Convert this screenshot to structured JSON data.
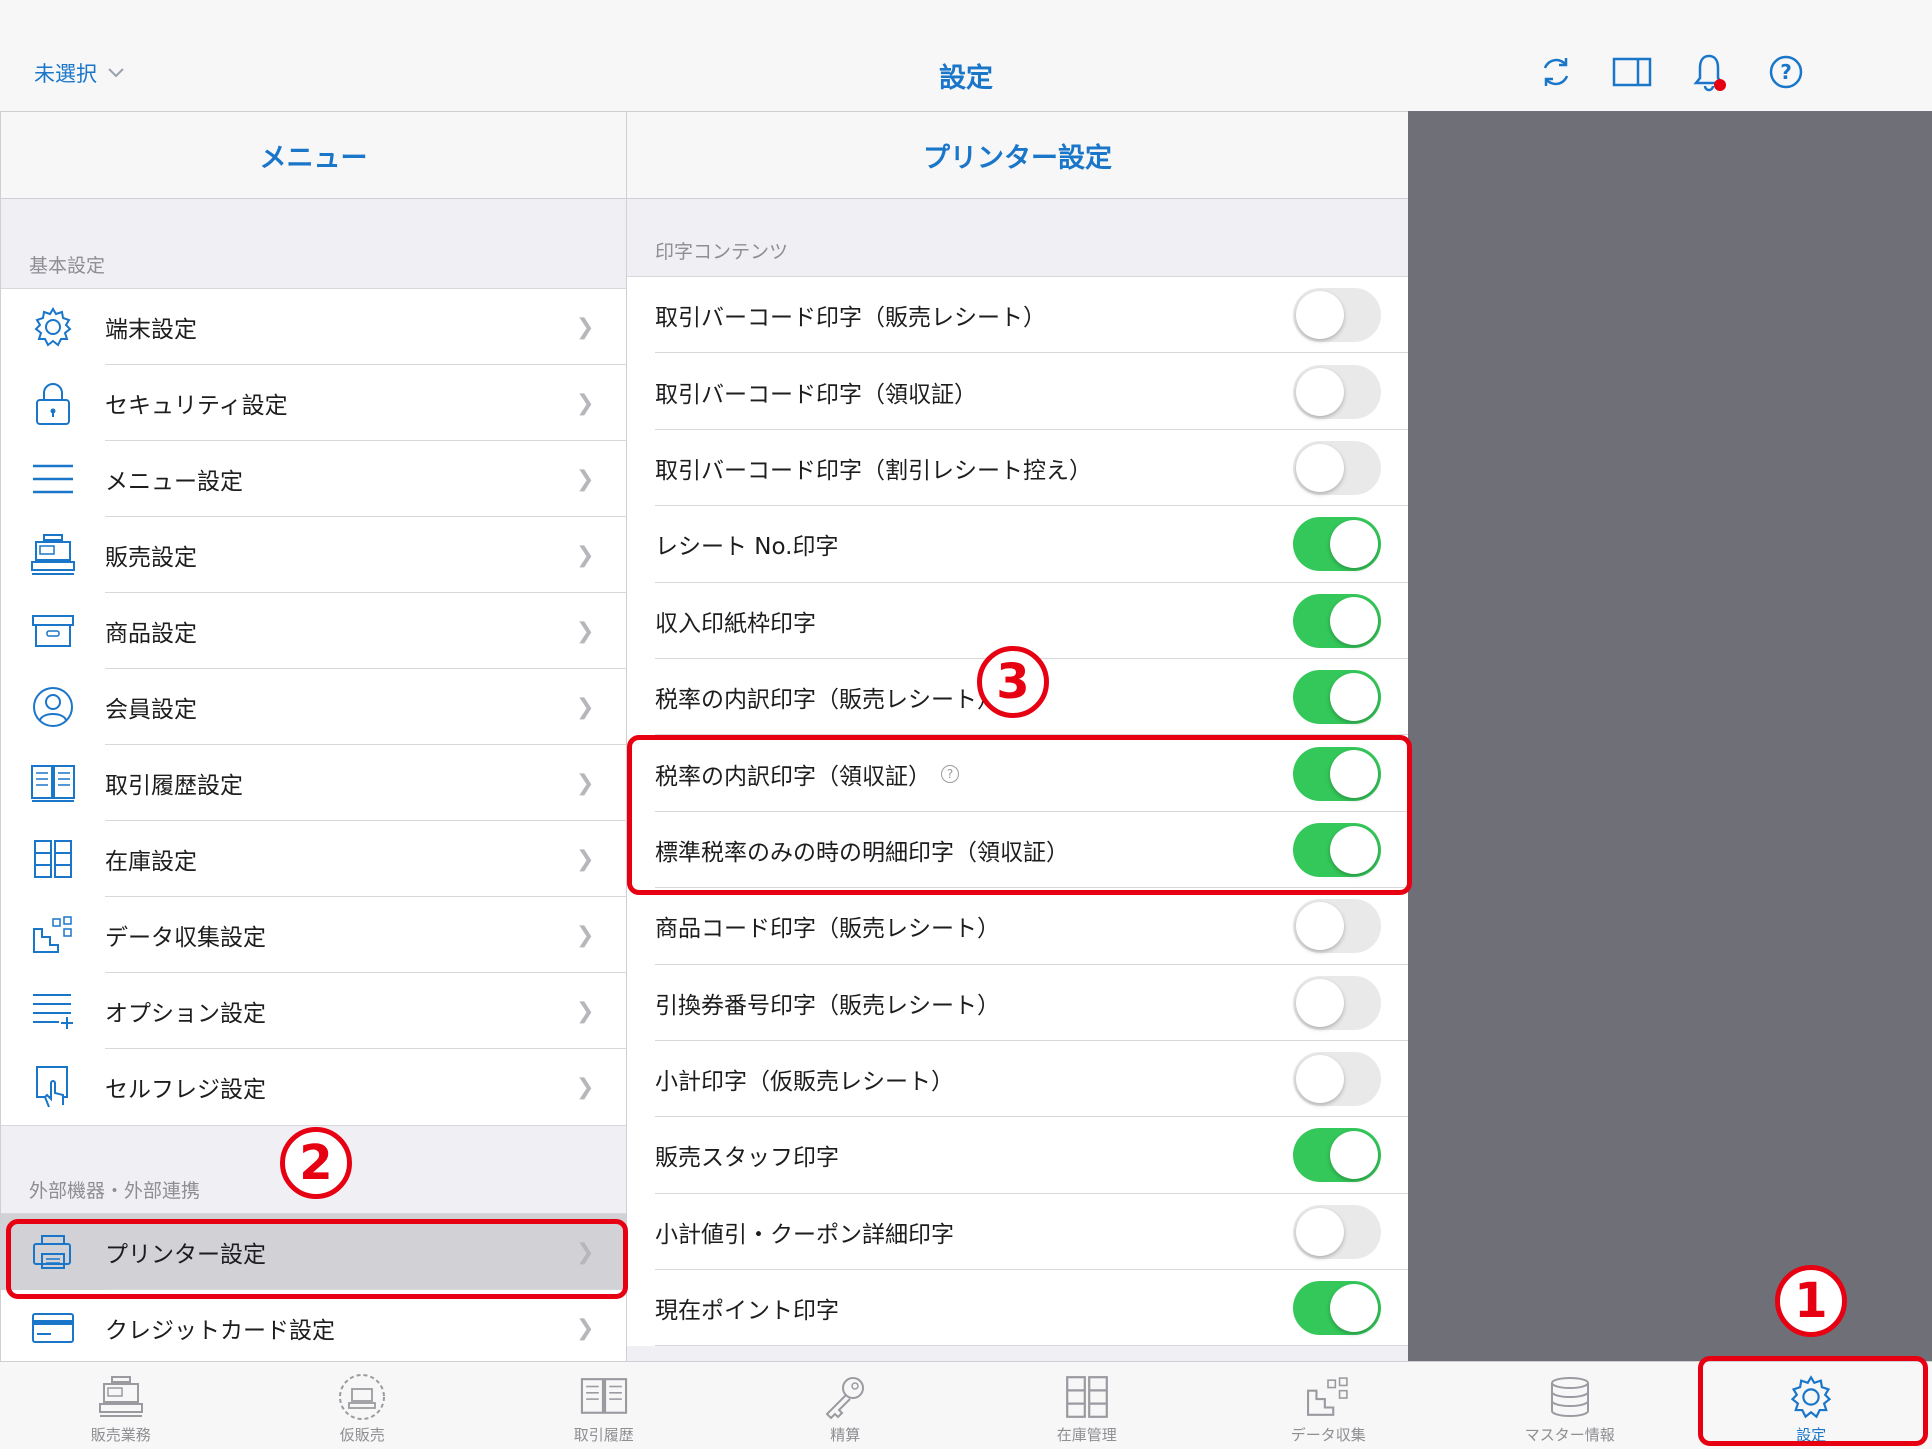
{
  "header": {
    "store_select": "未選択",
    "title": "設定",
    "icons": [
      "refresh-icon",
      "split-view-icon",
      "bell-icon",
      "help-icon"
    ],
    "notification_dot_color": "#e60012"
  },
  "menu": {
    "title": "メニュー",
    "sections": [
      {
        "label": "基本設定",
        "items": [
          {
            "label": "端末設定",
            "icon": "gear-icon"
          },
          {
            "label": "セキュリティ設定",
            "icon": "lock-icon"
          },
          {
            "label": "メニュー設定",
            "icon": "hamburger-icon"
          },
          {
            "label": "販売設定",
            "icon": "register-icon"
          },
          {
            "label": "商品設定",
            "icon": "box-icon"
          },
          {
            "label": "会員設定",
            "icon": "user-icon"
          },
          {
            "label": "取引履歴設定",
            "icon": "book-icon"
          },
          {
            "label": "在庫設定",
            "icon": "cabinet-icon"
          },
          {
            "label": "データ収集設定",
            "icon": "data-icon"
          },
          {
            "label": "オプション設定",
            "icon": "list-plus-icon"
          },
          {
            "label": "セルフレジ設定",
            "icon": "touch-icon"
          }
        ]
      },
      {
        "label": "外部機器・外部連携",
        "items": [
          {
            "label": "プリンター設定",
            "icon": "printer-icon",
            "selected": true
          },
          {
            "label": "クレジットカード設定",
            "icon": "card-icon"
          }
        ]
      }
    ]
  },
  "printer": {
    "title": "プリンター設定",
    "section_label": "印字コンテンツ",
    "rows": [
      {
        "label": "取引バーコード印字（販売レシート）",
        "on": false
      },
      {
        "label": "取引バーコード印字（領収証）",
        "on": false
      },
      {
        "label": "取引バーコード印字（割引レシート控え）",
        "on": false
      },
      {
        "label": "レシート No.印字",
        "on": true
      },
      {
        "label": "収入印紙枠印字",
        "on": true
      },
      {
        "label": "税率の内訳印字（販売レシート）",
        "on": true
      },
      {
        "label": "税率の内訳印字（領収証）",
        "on": true,
        "help": "?"
      },
      {
        "label": "標準税率のみの時の明細印字（領収証）",
        "on": true
      },
      {
        "label": "商品コード印字（販売レシート）",
        "on": false
      },
      {
        "label": "引換券番号印字（販売レシート）",
        "on": false
      },
      {
        "label": "小計印字（仮販売レシート）",
        "on": false
      },
      {
        "label": "販売スタッフ印字",
        "on": true
      },
      {
        "label": "小計値引・クーポン詳細印字",
        "on": false
      },
      {
        "label": "現在ポイント印字",
        "on": true
      }
    ]
  },
  "tabbar": {
    "tabs": [
      {
        "label": "販売業務",
        "icon": "register-icon"
      },
      {
        "label": "仮販売",
        "icon": "temp-register-icon"
      },
      {
        "label": "取引履歴",
        "icon": "book-icon"
      },
      {
        "label": "精算",
        "icon": "key-icon"
      },
      {
        "label": "在庫管理",
        "icon": "cabinet-icon"
      },
      {
        "label": "データ収集",
        "icon": "data-icon"
      },
      {
        "label": "マスター情報",
        "icon": "database-icon"
      },
      {
        "label": "設定",
        "icon": "gear-icon",
        "active": true
      }
    ]
  },
  "annotations": {
    "step1": "1",
    "step2": "2",
    "step3": "3",
    "color": "#e60012"
  },
  "colors": {
    "accent": "#1a76c9",
    "toggle_on": "#34c759",
    "side_gray": "#6f6f78"
  }
}
